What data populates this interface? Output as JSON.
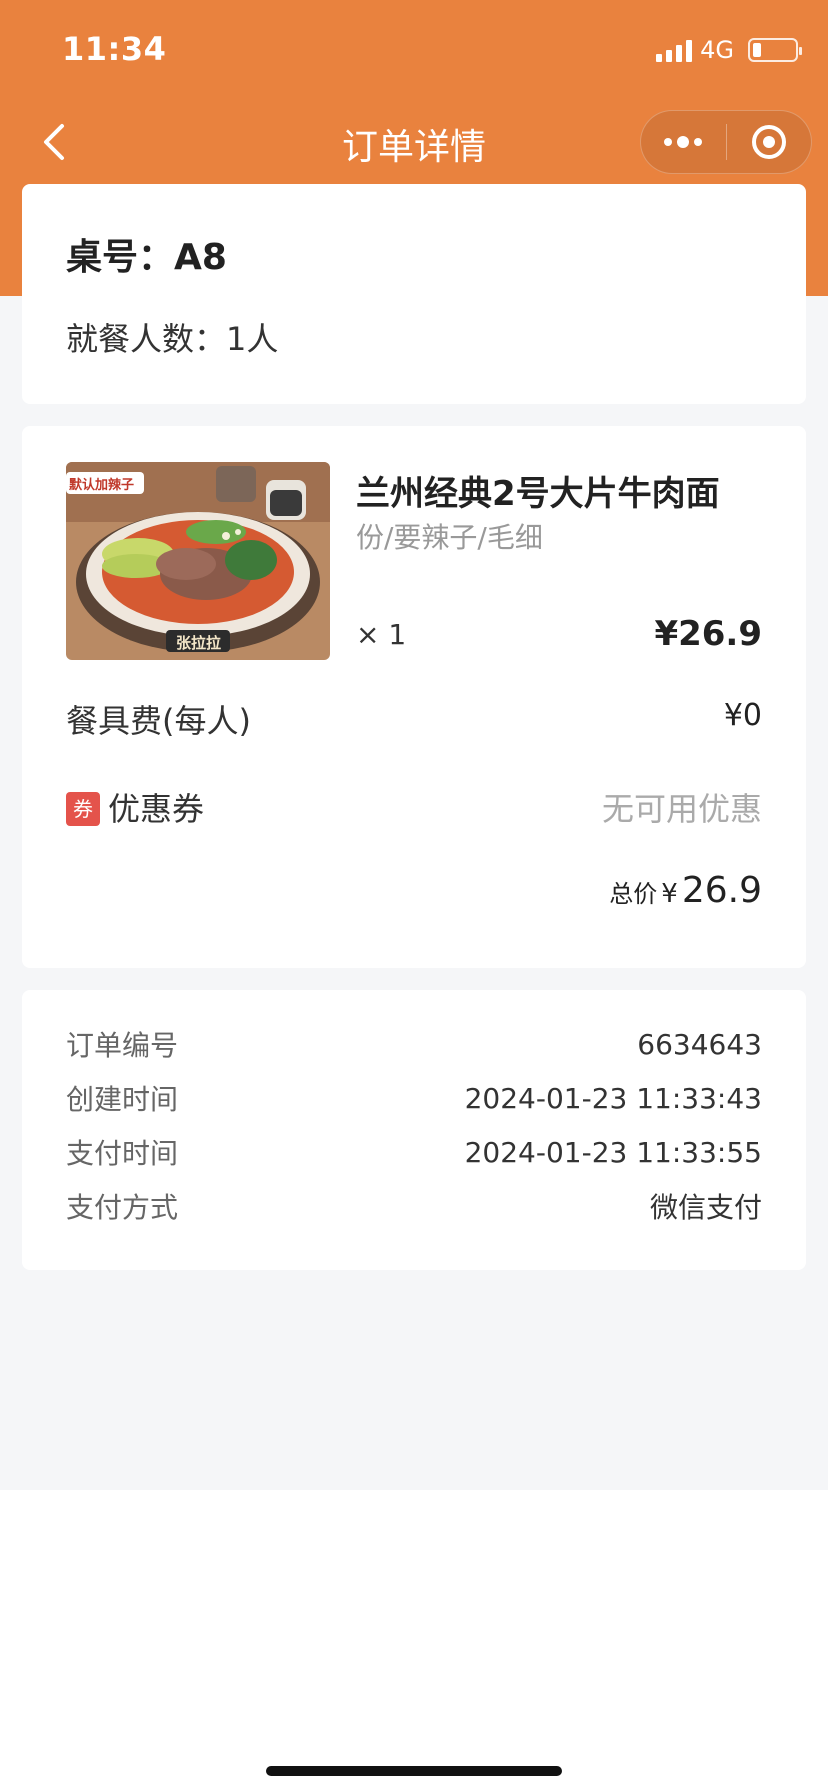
{
  "status_bar": {
    "time": "11:34",
    "network": "4G"
  },
  "navbar": {
    "title": "订单详情",
    "back_icon": "chevron-left-icon",
    "more_icon": "more-dots-icon",
    "close_icon": "target-circle-icon"
  },
  "table_info": {
    "table_no": "桌号：A8",
    "diners": "就餐人数：1人"
  },
  "item": {
    "image_badge": "默认加辣子",
    "image_brand": "张拉拉",
    "name": "兰州经典2号大片牛肉面",
    "spec": "份/要辣子/毛细",
    "qty": "× 1",
    "price": "¥26.9"
  },
  "fees": {
    "tableware_label": "餐具费(每人)",
    "tableware_value": "¥0"
  },
  "coupon": {
    "tag": "券",
    "label": "优惠券",
    "value": "无可用优惠"
  },
  "total": {
    "label": "总价",
    "currency": "¥",
    "amount": "26.9"
  },
  "order_info": [
    {
      "key": "订单编号",
      "value": "6634643"
    },
    {
      "key": "创建时间",
      "value": "2024-01-23 11:33:43"
    },
    {
      "key": "支付时间",
      "value": "2024-01-23 11:33:55"
    },
    {
      "key": "支付方式",
      "value": "微信支付"
    }
  ],
  "colors": {
    "brand": "#E9823E",
    "coupon_red": "#e4534b",
    "background": "#f5f6f8"
  }
}
